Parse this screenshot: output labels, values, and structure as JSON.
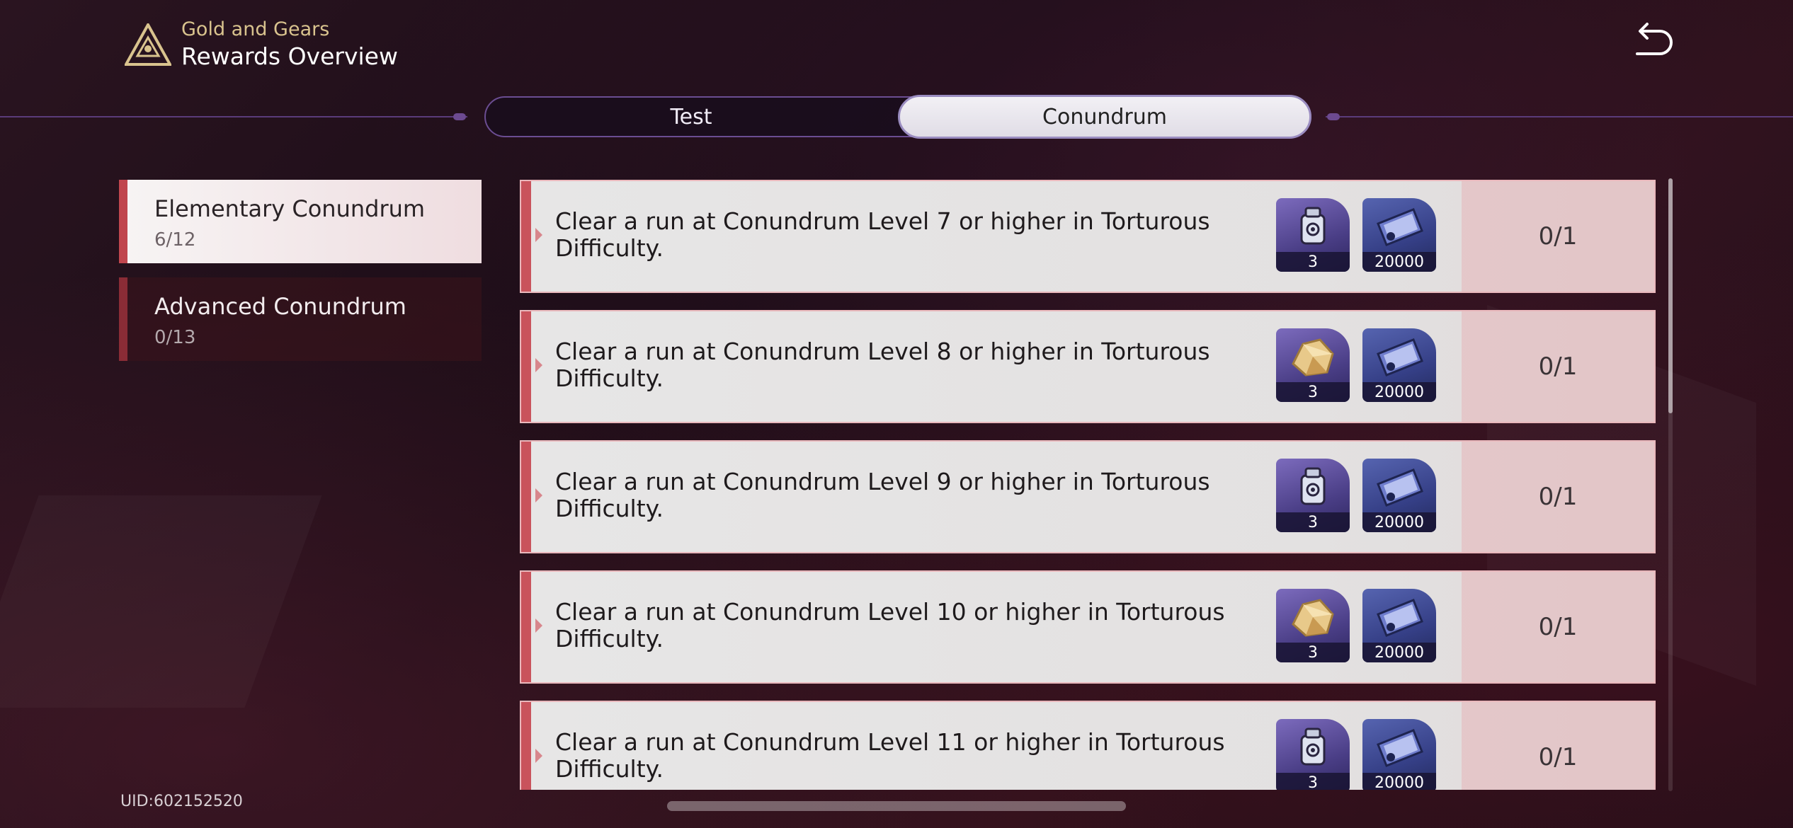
{
  "header": {
    "subtitle": "Gold and Gears",
    "title": "Rewards Overview"
  },
  "tabs": [
    {
      "label": "Test",
      "active": false
    },
    {
      "label": "Conundrum",
      "active": true
    }
  ],
  "sidebar": {
    "items": [
      {
        "name": "Elementary Conundrum",
        "count": "6/12",
        "active": true
      },
      {
        "name": "Advanced Conundrum",
        "count": "0/13",
        "active": false
      }
    ]
  },
  "missions": [
    {
      "desc": "Clear a run at Conundrum Level 7 or higher in Torturous Difficulty.",
      "reward1_icon": "cogwheel-bag-icon",
      "reward1_qty": "3",
      "reward2_icon": "ticket-icon",
      "reward2_qty": "20000",
      "progress": "0/1"
    },
    {
      "desc": "Clear a run at Conundrum Level 8 or higher in Torturous Difficulty.",
      "reward1_icon": "gold-ore-icon",
      "reward1_qty": "3",
      "reward2_icon": "ticket-icon",
      "reward2_qty": "20000",
      "progress": "0/1"
    },
    {
      "desc": "Clear a run at Conundrum Level 9 or higher in Torturous Difficulty.",
      "reward1_icon": "cogwheel-bag-icon",
      "reward1_qty": "3",
      "reward2_icon": "ticket-icon",
      "reward2_qty": "20000",
      "progress": "0/1"
    },
    {
      "desc": "Clear a run at Conundrum Level 10 or higher in Torturous Difficulty.",
      "reward1_icon": "gold-ore-icon",
      "reward1_qty": "3",
      "reward2_icon": "ticket-icon",
      "reward2_qty": "20000",
      "progress": "0/1"
    },
    {
      "desc": "Clear a run at Conundrum Level 11 or higher in Torturous Difficulty.",
      "reward1_icon": "cogwheel-bag-icon",
      "reward1_qty": "3",
      "reward2_icon": "ticket-icon",
      "reward2_qty": "20000",
      "progress": "0/1"
    }
  ],
  "footer": {
    "uid": "UID:602152520"
  },
  "colors": {
    "accent_red": "#c9535c",
    "gold": "#d9c38e",
    "tab_border": "#6b4d92"
  }
}
